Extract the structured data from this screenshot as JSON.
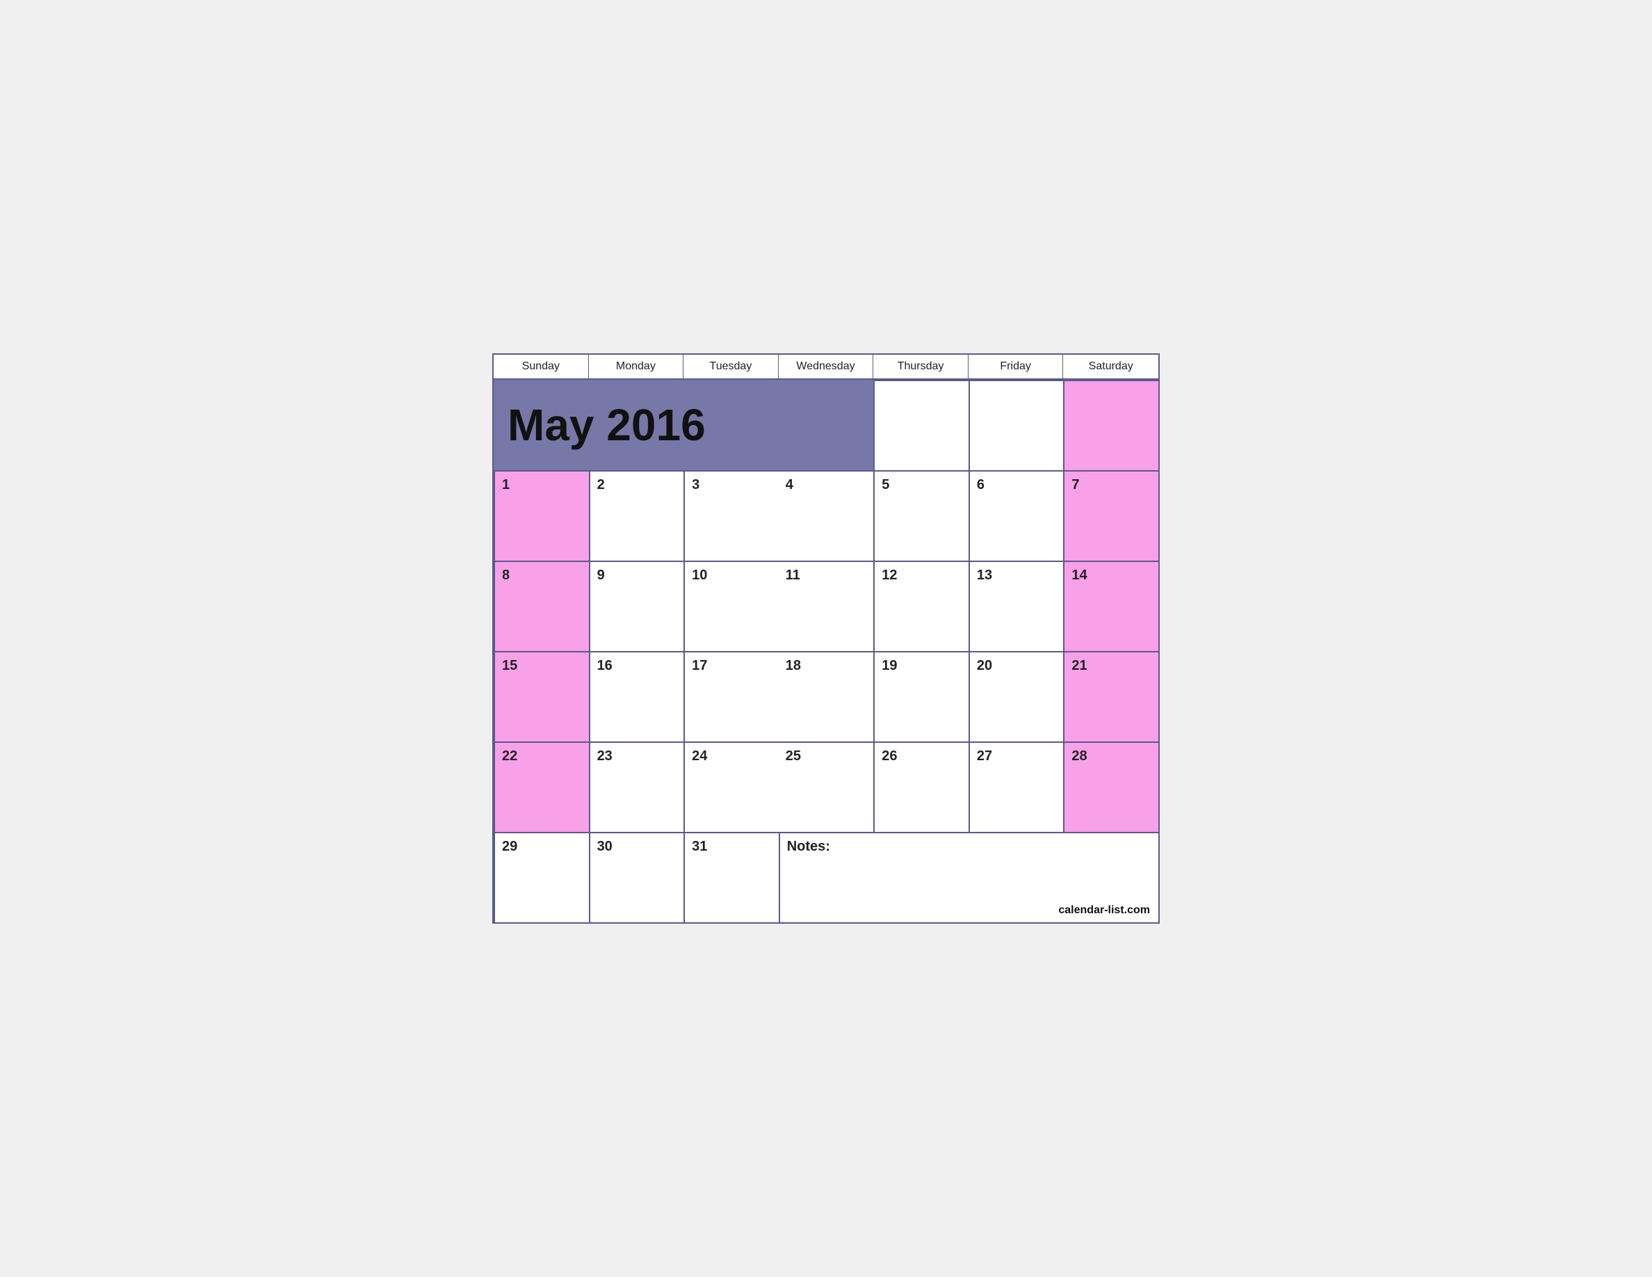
{
  "calendar": {
    "title": "May 2016",
    "watermark": "calendar-list.com",
    "days_of_week": [
      "Sunday",
      "Monday",
      "Tuesday",
      "Wednesday",
      "Thursday",
      "Friday",
      "Saturday"
    ],
    "notes_label": "Notes:",
    "weeks": [
      {
        "days": [
          {
            "number": null,
            "type": "title-span"
          },
          {
            "number": null,
            "type": "empty"
          },
          {
            "number": null,
            "type": "empty"
          },
          {
            "number": null,
            "type": "empty",
            "weekend": true
          }
        ]
      },
      {
        "days": [
          {
            "number": "1",
            "weekend": true,
            "day": "sunday"
          },
          {
            "number": "2",
            "day": "monday"
          },
          {
            "number": "3",
            "day": "tuesday"
          },
          {
            "number": "4",
            "day": "wednesday"
          },
          {
            "number": "5",
            "day": "thursday"
          },
          {
            "number": "6",
            "day": "friday"
          },
          {
            "number": "7",
            "weekend": true,
            "day": "saturday"
          }
        ]
      },
      {
        "days": [
          {
            "number": "8",
            "weekend": true,
            "day": "sunday"
          },
          {
            "number": "9",
            "day": "monday"
          },
          {
            "number": "10",
            "day": "tuesday"
          },
          {
            "number": "11",
            "day": "wednesday"
          },
          {
            "number": "12",
            "day": "thursday"
          },
          {
            "number": "13",
            "day": "friday"
          },
          {
            "number": "14",
            "weekend": true,
            "day": "saturday"
          }
        ]
      },
      {
        "days": [
          {
            "number": "15",
            "weekend": true,
            "day": "sunday"
          },
          {
            "number": "16",
            "day": "monday"
          },
          {
            "number": "17",
            "day": "tuesday"
          },
          {
            "number": "18",
            "day": "wednesday"
          },
          {
            "number": "19",
            "day": "thursday"
          },
          {
            "number": "20",
            "day": "friday"
          },
          {
            "number": "21",
            "weekend": true,
            "day": "saturday"
          }
        ]
      },
      {
        "days": [
          {
            "number": "22",
            "weekend": true,
            "day": "sunday"
          },
          {
            "number": "23",
            "day": "monday"
          },
          {
            "number": "24",
            "day": "tuesday"
          },
          {
            "number": "25",
            "day": "wednesday"
          },
          {
            "number": "26",
            "day": "thursday"
          },
          {
            "number": "27",
            "day": "friday"
          },
          {
            "number": "28",
            "weekend": true,
            "day": "saturday"
          }
        ]
      },
      {
        "days": [
          {
            "number": "29",
            "day": "sunday"
          },
          {
            "number": "30",
            "day": "monday"
          },
          {
            "number": "31",
            "day": "tuesday"
          },
          {
            "number": null,
            "type": "notes",
            "span": 4
          }
        ]
      }
    ]
  }
}
